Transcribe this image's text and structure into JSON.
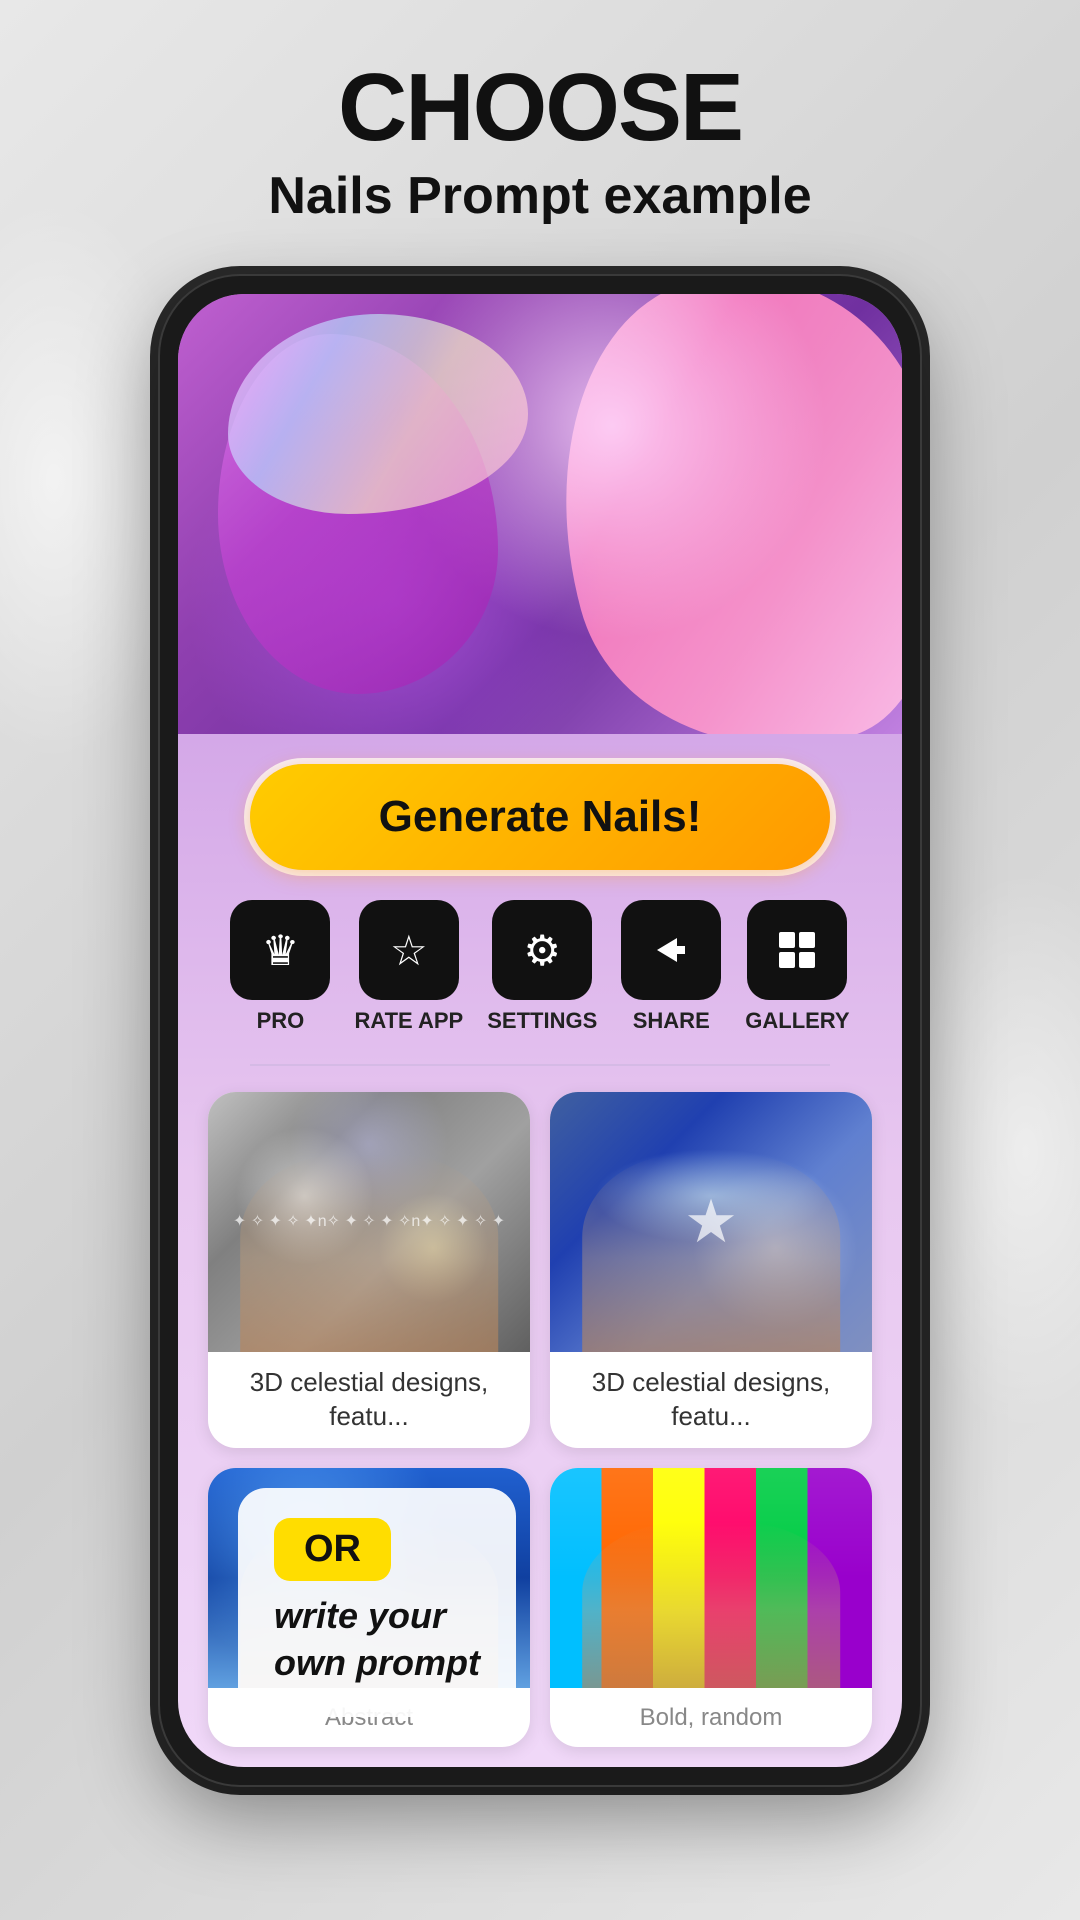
{
  "header": {
    "title": "CHOOSE",
    "subtitle": "Nails Prompt example"
  },
  "generate_button": {
    "label": "Generate Nails!"
  },
  "actions": [
    {
      "id": "pro",
      "icon": "♛",
      "label": "PRO"
    },
    {
      "id": "rate",
      "icon": "☆",
      "label": "RATE APP"
    },
    {
      "id": "settings",
      "icon": "⚙",
      "label": "SETTINGS"
    },
    {
      "id": "share",
      "icon": "◁",
      "label": "SHARE"
    },
    {
      "id": "gallery",
      "icon": "▦",
      "label": "GALLERY"
    }
  ],
  "nail_cards": [
    {
      "id": "card-1",
      "image_type": "silver-glitter",
      "label": "3D celestial designs, featu..."
    },
    {
      "id": "card-2",
      "image_type": "blue-cat-eye",
      "label": "3D celestial designs, featu..."
    },
    {
      "id": "card-3",
      "image_type": "blue-gradient",
      "label": "Abstract"
    },
    {
      "id": "card-4",
      "image_type": "colorful-stripes",
      "label": "Bold, random"
    }
  ],
  "or_prompt": {
    "or_label": "OR",
    "prompt_text": "write your\nown prompt"
  }
}
